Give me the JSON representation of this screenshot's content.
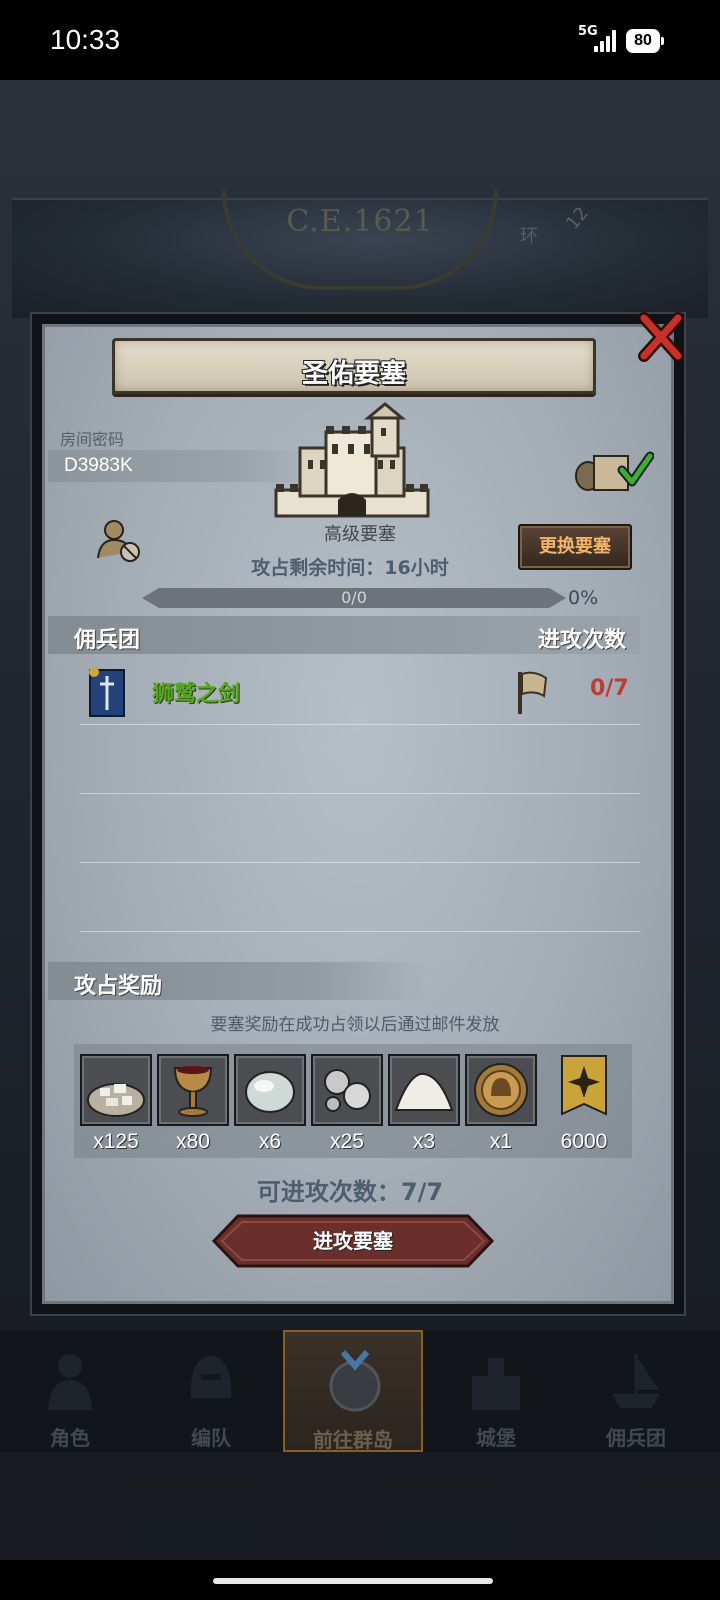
{
  "status_bar": {
    "time": "10:33",
    "network": "5G",
    "battery": "80"
  },
  "background": {
    "era": "C.E.1621",
    "map_labels": [
      "环",
      "12"
    ]
  },
  "modal": {
    "title": "圣佑要塞",
    "room": {
      "label": "房间密码",
      "code": "D3983K"
    },
    "fortress_level": "高级要塞",
    "change_button": "更换要塞",
    "remaining_time": "攻占剩余时间：16小时",
    "progress": {
      "text": "0/0",
      "percent": "0%",
      "value": 0
    },
    "mercenary": {
      "header_left": "佣兵团",
      "header_right": "进攻次数",
      "rows": [
        {
          "name": "狮鹫之剑",
          "attacks": "0/7"
        }
      ]
    },
    "rewards": {
      "header": "攻占奖励",
      "note": "要塞奖励在成功占领以后通过邮件发放",
      "items": [
        {
          "icon": "stone-pile-icon",
          "qty": "x125"
        },
        {
          "icon": "goblet-icon",
          "qty": "x80"
        },
        {
          "icon": "gem-icon",
          "qty": "x6"
        },
        {
          "icon": "silver-ore-icon",
          "qty": "x25"
        },
        {
          "icon": "flour-pile-icon",
          "qty": "x3"
        },
        {
          "icon": "helmet-medal-icon",
          "qty": "x1"
        },
        {
          "icon": "rank-badge-icon",
          "qty": "6000"
        }
      ]
    },
    "attack_count": "可进攻次数：7/7",
    "attack_button": "进攻要塞"
  },
  "nav": {
    "items": [
      {
        "label": "角色",
        "icon": "knight-icon"
      },
      {
        "label": "编队",
        "icon": "helmet-icon"
      },
      {
        "label": "前往群岛",
        "icon": "compass-globe-icon",
        "active": true
      },
      {
        "label": "城堡",
        "icon": "castle-icon"
      },
      {
        "label": "佣兵团",
        "icon": "ship-icon"
      }
    ]
  },
  "colors": {
    "accent_gold": "#f2b46a",
    "merc_green": "#55a81f",
    "count_red": "#bf3c36"
  }
}
